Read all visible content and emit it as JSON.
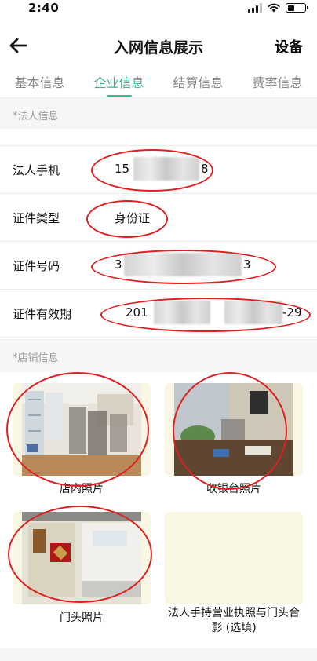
{
  "status_bar": {
    "time": "2:40"
  },
  "nav": {
    "title": "入网信息展示",
    "right_action": "设备"
  },
  "tabs": [
    {
      "label": "基本信息",
      "active": false
    },
    {
      "label": "企业信息",
      "active": true
    },
    {
      "label": "结算信息",
      "active": false
    },
    {
      "label": "费率信息",
      "active": false
    }
  ],
  "legal_section": {
    "header": "*法人信息",
    "rows": [
      {
        "label": "法人手机",
        "value_prefix": "15",
        "value_suffix": "8"
      },
      {
        "label": "证件类型",
        "value": "身份证"
      },
      {
        "label": "证件号码",
        "value_prefix": "3",
        "value_suffix": "3"
      },
      {
        "label": "证件有效期",
        "value_prefix": "201",
        "value_suffix": "-29"
      }
    ]
  },
  "store_section": {
    "header": "*店铺信息",
    "photos": [
      {
        "caption": "店内照片"
      },
      {
        "caption": "收银台照片"
      },
      {
        "caption": "门头照片"
      },
      {
        "caption": "法人手持营业执照与门头合影 (选填)"
      }
    ]
  },
  "colors": {
    "accent": "#3db889",
    "annotation": "#e02020",
    "card_bg": "#faf6e4"
  }
}
